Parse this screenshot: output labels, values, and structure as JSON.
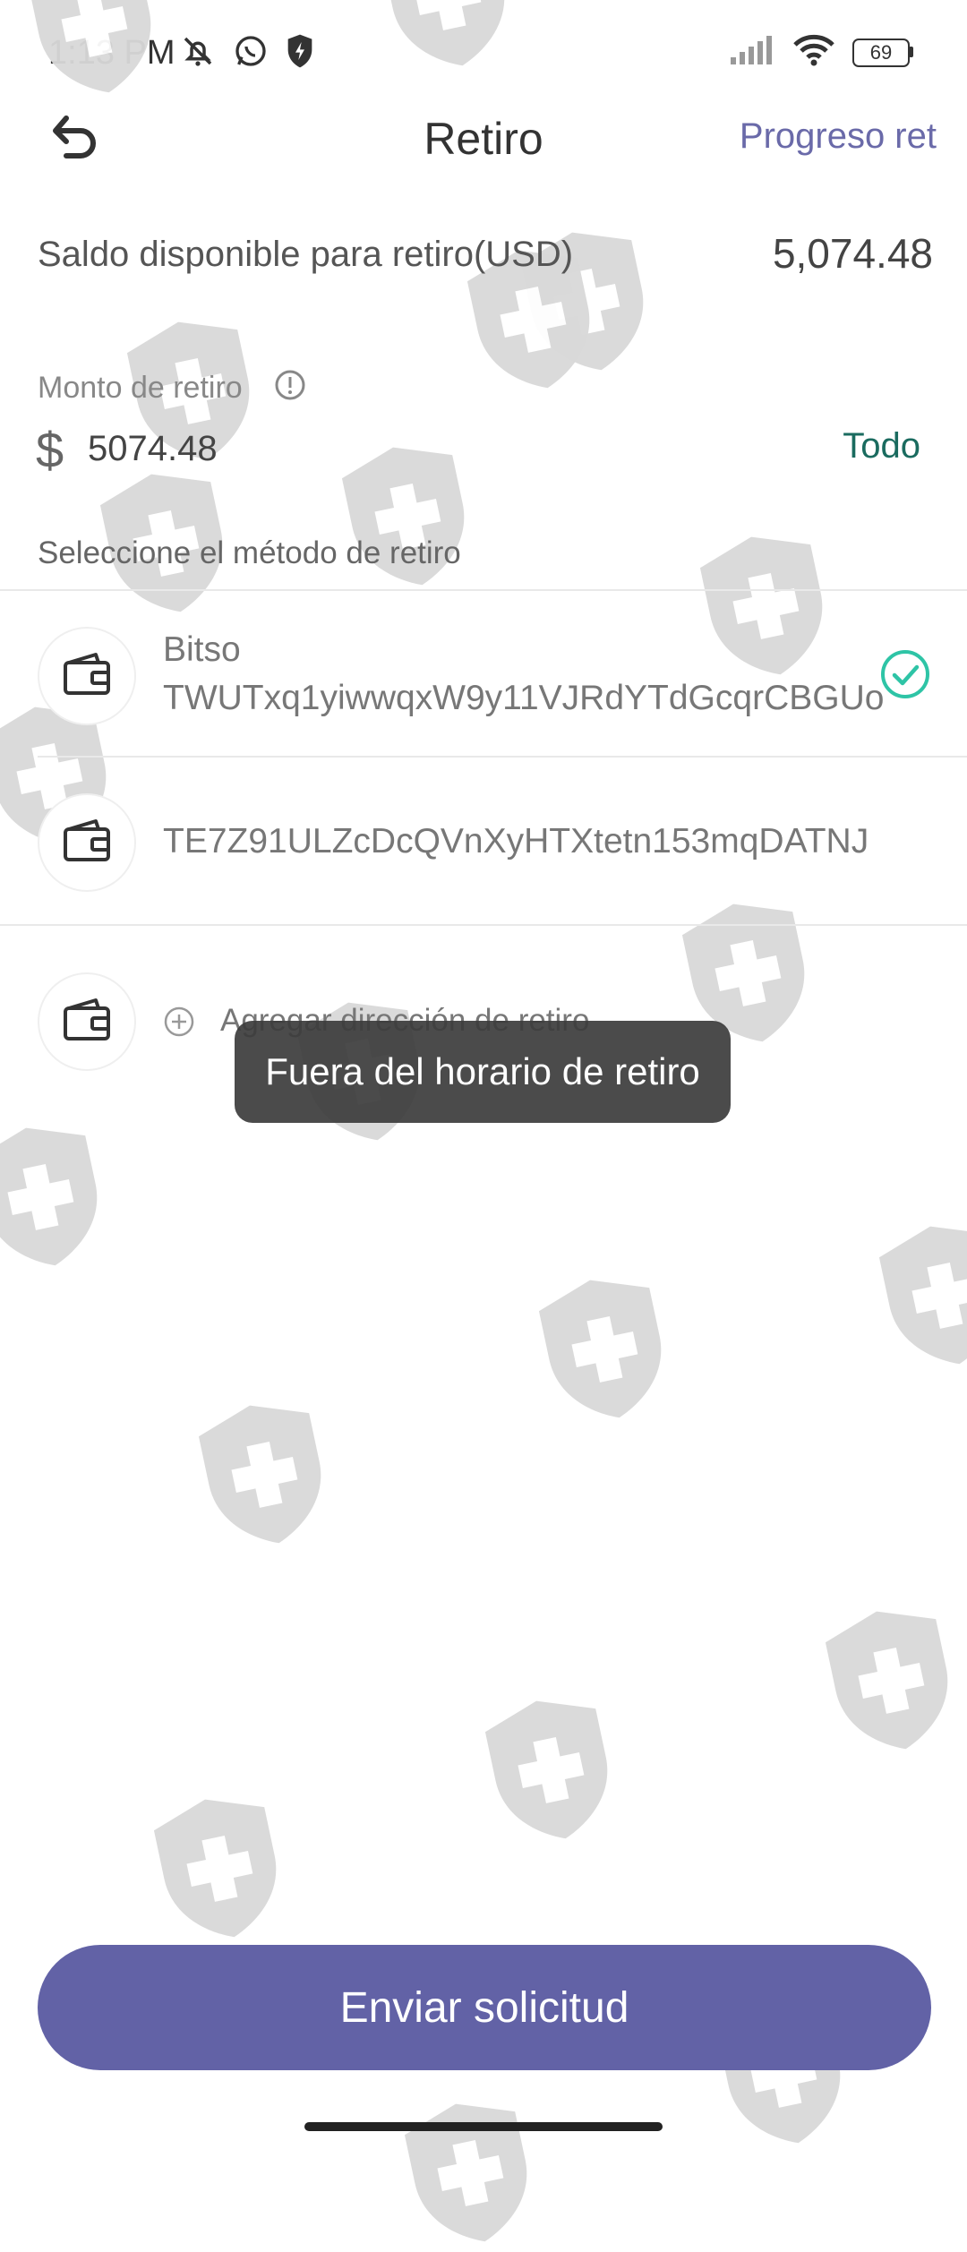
{
  "status_bar": {
    "time": "1:13 PM",
    "battery": "69",
    "icons_left": [
      "mute-bell-icon",
      "whatsapp-icon",
      "shield-bolt-icon"
    ],
    "icons_right": [
      "signal-icon",
      "wifi-icon",
      "battery-icon"
    ]
  },
  "header": {
    "title": "Retiro",
    "progress_link": "Progreso ret"
  },
  "balance": {
    "label": "Saldo disponible para retiro(USD)",
    "value": "5,074.48"
  },
  "amount": {
    "label": "Monto de retiro",
    "currency_symbol": "$",
    "value": "5074.48",
    "all_label": "Todo"
  },
  "methods": {
    "section_label": "Seleccione el método de retiro",
    "items": [
      {
        "name": "Bitso",
        "address": "TWUTxq1yiwwqxW9y11VJRdYTdGcqrCBGUo",
        "selected": true
      },
      {
        "name": "",
        "address": "TE7Z91ULZcDcQVnXyHTXtetn153mqDATNJ",
        "selected": false
      }
    ],
    "add_label": "Agregar dirección de retiro"
  },
  "toast": "Fuera del horario de retiro",
  "submit_label": "Enviar solicitud",
  "colors": {
    "accent": "#6262a6",
    "link": "#6a6aa9",
    "all_link": "#1a6b5f",
    "check": "#2ec4a6",
    "watermark": "#d9d9d9"
  }
}
